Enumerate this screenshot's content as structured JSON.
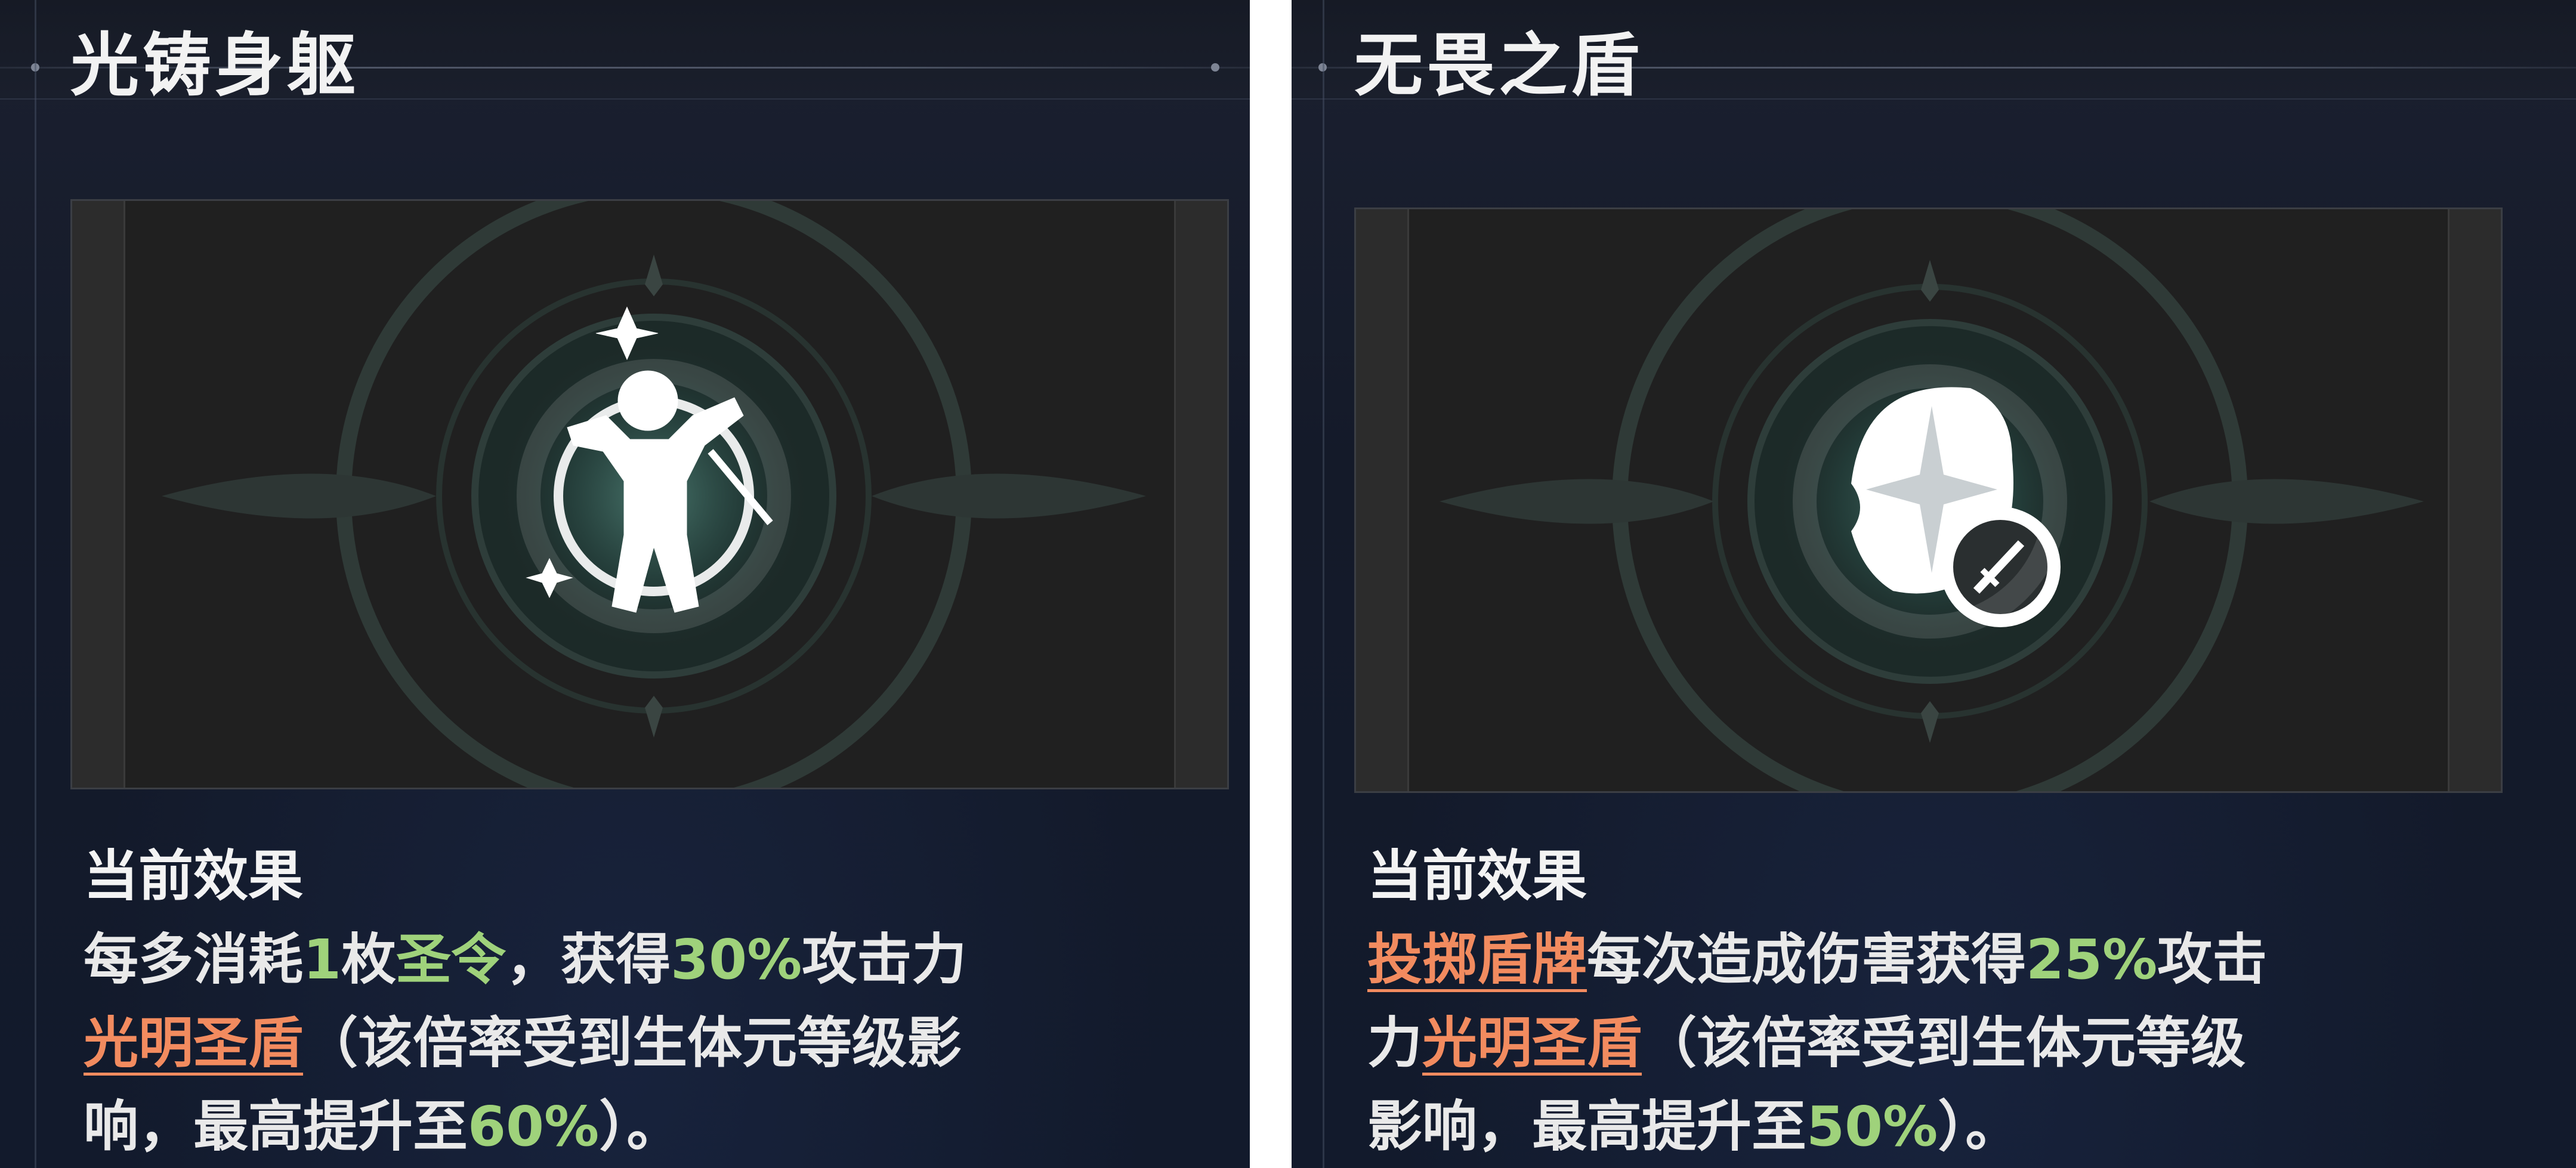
{
  "cards": [
    {
      "title": "光铸身躯",
      "icon": "glowing-figure-icon",
      "section_label": "当前效果",
      "line1": [
        "每多消耗",
        "1",
        "枚",
        "圣令",
        "，获得",
        "30%",
        "攻击力"
      ],
      "line2": [
        "光明圣盾",
        "（该倍率受到生体元等级影"
      ],
      "line3": [
        "响，最高提升至",
        "60%",
        "）。"
      ]
    },
    {
      "title": "无畏之盾",
      "icon": "shield-sword-icon",
      "section_label": "当前效果",
      "line1": [
        "投掷盾牌",
        "每次造成伤害获得",
        "25%",
        "攻击"
      ],
      "line2": [
        "力",
        "光明圣盾",
        "（该倍率受到生体元等级"
      ],
      "line3": [
        "影响，最高提升至",
        "50%",
        "）。"
      ]
    }
  ],
  "colors": {
    "highlight_green": "#9fd27b",
    "keyword_orange": "#f28b5f",
    "text": "#e9e9e9"
  }
}
